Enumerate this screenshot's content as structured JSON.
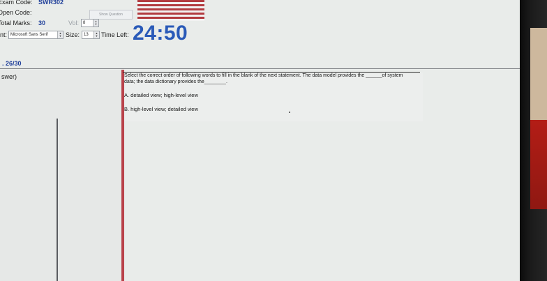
{
  "header": {
    "exam_code_label": "Exam Code:",
    "exam_code_value": "SWR302",
    "open_code_label": "Open Code:",
    "show_question_label": "Show Question",
    "total_marks_label": "Total Marks:",
    "total_marks_value": "30",
    "vol_label": "Vol:",
    "vol_value": "8",
    "font_label": "nt:",
    "font_value": "Microsoft Sans Serif",
    "size_label": "Size:",
    "size_value": "13",
    "time_left_label": "Time Left:",
    "timer_value": "24:50"
  },
  "progress": {
    "text": ". 26/30"
  },
  "left_panel": {
    "label": "swer)"
  },
  "question": {
    "text": "Select the correct order of following words to fill in the blank of the next statement. The data model provides the ______of system data; the data dictionary provides the________.",
    "options": [
      "A.  detailed view; high-level view",
      "B.  high-level view; detailed view"
    ]
  },
  "colors": {
    "accent": "#2a5ab8",
    "label_value": "#1f3f9a",
    "red_divider": "#b9424a",
    "background": "#e9ecea"
  },
  "icons": [
    "spinner-arrows-icon",
    "flag-image"
  ]
}
